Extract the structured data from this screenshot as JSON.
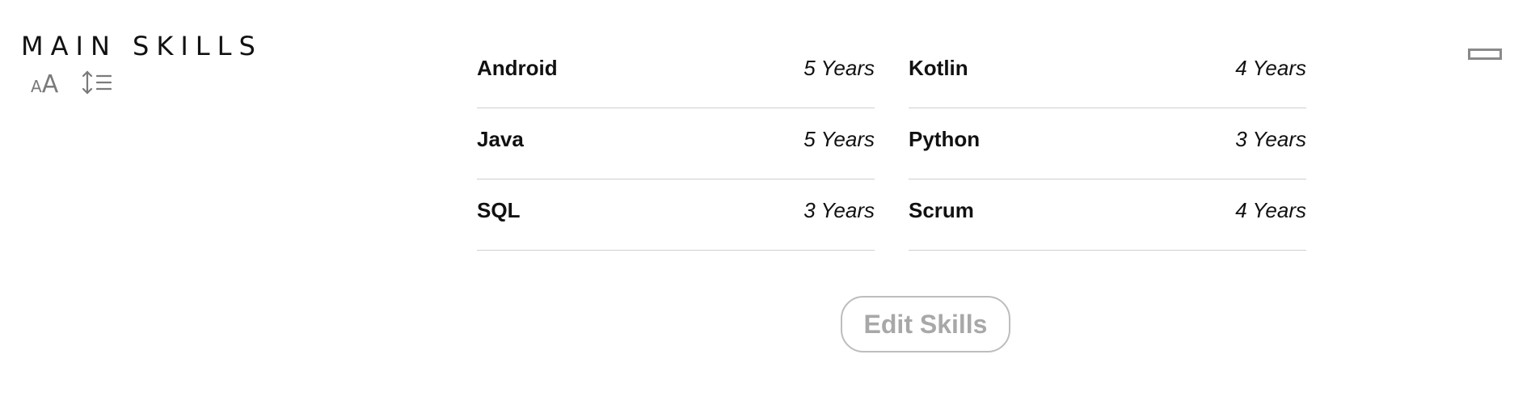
{
  "section": {
    "title": "MAIN SKILLS"
  },
  "tools": {
    "text_size_small": "A",
    "text_size_large": "A"
  },
  "skills": [
    {
      "name": "Android",
      "years": "5 Years"
    },
    {
      "name": "Kotlin",
      "years": "4 Years"
    },
    {
      "name": "Java",
      "years": "5 Years"
    },
    {
      "name": "Python",
      "years": "3 Years"
    },
    {
      "name": "SQL",
      "years": "3 Years"
    },
    {
      "name": "Scrum",
      "years": "4 Years"
    }
  ],
  "actions": {
    "edit_label": "Edit Skills"
  },
  "colors": {
    "text": "#111111",
    "muted": "#777777",
    "divider": "#cfcfcf",
    "button_text": "#a8a8a8",
    "button_border": "#bdbdbd"
  },
  "icons": {
    "text_size": "text-size-icon",
    "line_spacing": "line-spacing-icon",
    "window_control": "minimize-rect-icon"
  }
}
